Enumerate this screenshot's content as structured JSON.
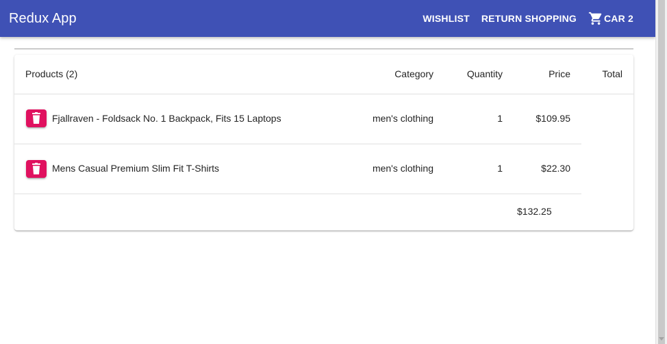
{
  "app": {
    "title": "Redux App"
  },
  "nav": {
    "wishlist_label": "WISHLIST",
    "return_label": "RETURN SHOPPING",
    "cart_label": "CAR 2",
    "cart_icon": "shopping-cart-icon"
  },
  "table": {
    "headers": {
      "products": "Products (2)",
      "category": "Category",
      "quantity": "Quantity",
      "price": "Price",
      "total": "Total"
    },
    "rows": [
      {
        "name": "Fjallraven - Foldsack No. 1 Backpack, Fits 15 Laptops",
        "category": "men's clothing",
        "quantity": "1",
        "price": "$109.95",
        "delete_icon": "trash-icon"
      },
      {
        "name": "Mens Casual Premium Slim Fit T-Shirts",
        "category": "men's clothing",
        "quantity": "1",
        "price": "$22.30",
        "delete_icon": "trash-icon"
      }
    ],
    "grand_total": "$132.25"
  },
  "colors": {
    "appbar": "#3f51b5",
    "delete_button": "#e0115f"
  }
}
